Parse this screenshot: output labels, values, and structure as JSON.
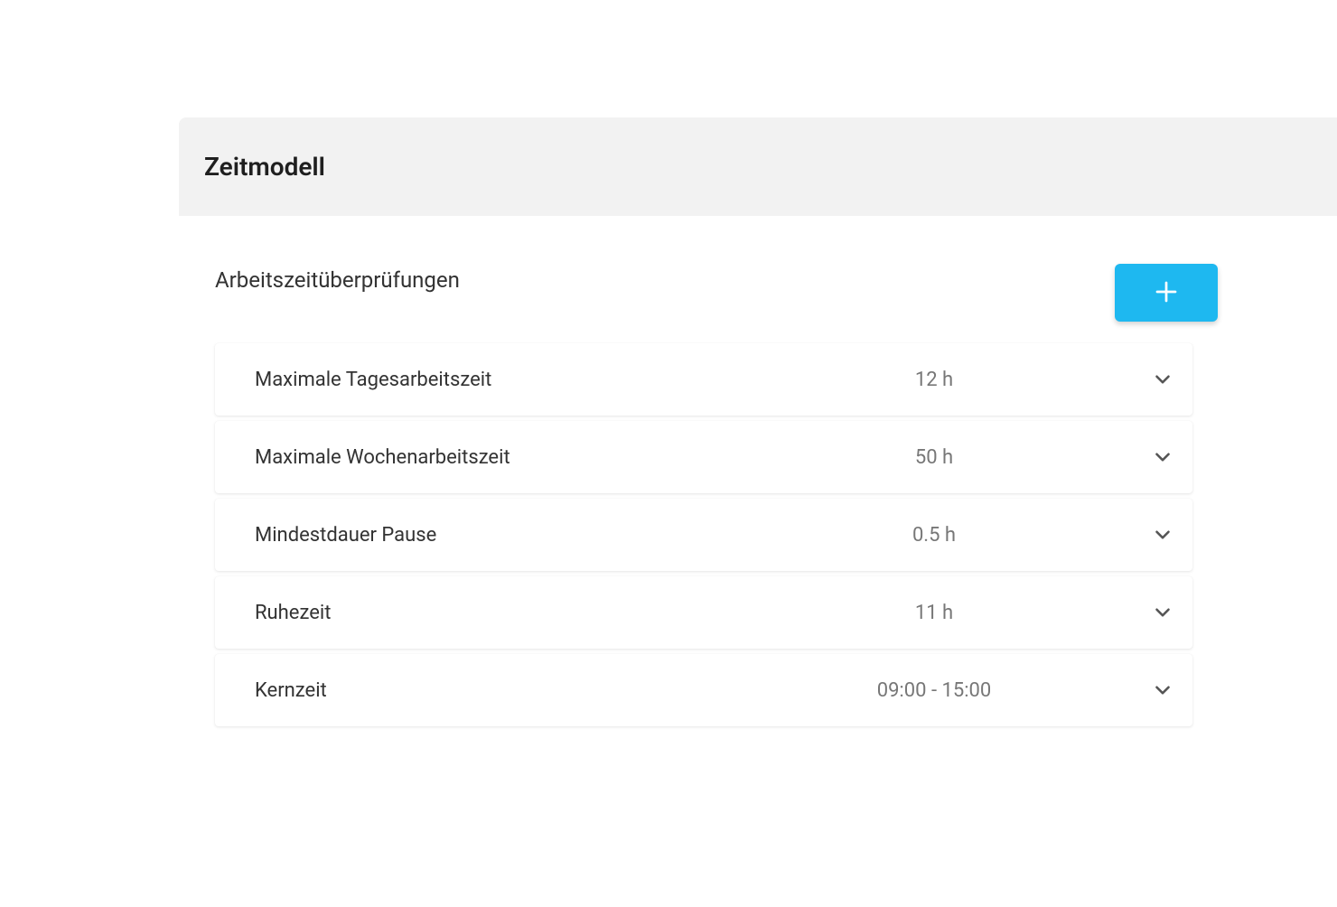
{
  "header": {
    "title": "Zeitmodell"
  },
  "section": {
    "title": "Arbeitszeitüberprüfungen"
  },
  "rows": [
    {
      "label": "Maximale Tagesarbeitszeit",
      "value": "12 h"
    },
    {
      "label": "Maximale Wochenarbeitszeit",
      "value": "50 h"
    },
    {
      "label": "Mindestdauer Pause",
      "value": "0.5 h"
    },
    {
      "label": "Ruhezeit",
      "value": "11 h"
    },
    {
      "label": "Kernzeit",
      "value": "09:00 - 15:00"
    }
  ],
  "colors": {
    "accent": "#1eb8f0"
  }
}
